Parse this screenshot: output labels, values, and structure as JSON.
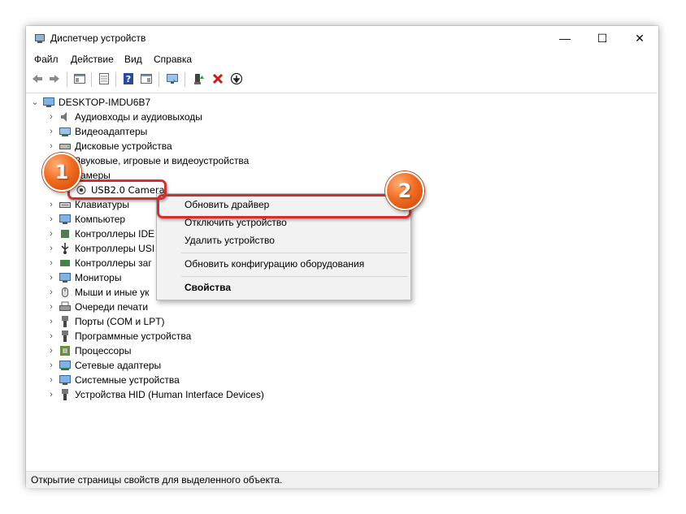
{
  "window": {
    "title": "Диспетчер устройств",
    "controls": {
      "minimize": "—",
      "maximize": "☐",
      "close": "✕"
    }
  },
  "menu": [
    "Файл",
    "Действие",
    "Вид",
    "Справка"
  ],
  "toolbar": {
    "icons": [
      "back-icon",
      "forward-icon",
      "show-hide-tree-icon",
      "properties-icon",
      "help-icon",
      "view-icon",
      "monitor-icon",
      "update-driver-icon",
      "uninstall-icon",
      "disable-icon"
    ]
  },
  "tree": {
    "root": "DESKTOP-IMDU6B7",
    "categories": [
      "Аудиовходы и аудиовыходы",
      "Видеоадаптеры",
      "Дисковые устройства",
      "Звуковые, игровые и видеоустройства",
      "Камеры",
      "USB2.0 Camera",
      "Клавиатуры",
      "Компьютер",
      "Контроллеры IDE",
      "Контроллеры USI",
      "Контроллеры заг",
      "Мониторы",
      "Мыши и иные ук",
      "Очереди печати",
      "Порты (COM и LPT)",
      "Программные устройства",
      "Процессоры",
      "Сетевые адаптеры",
      "Системные устройства",
      "Устройства HID (Human Interface Devices)"
    ]
  },
  "context_menu": {
    "items": [
      "Обновить драйвер",
      "Отключить устройство",
      "Удалить устройство",
      "Обновить конфигурацию оборудования",
      "Свойства"
    ]
  },
  "status": "Открытие страницы свойств для выделенного объекта.",
  "annotations": {
    "badge1": "1",
    "badge2": "2"
  },
  "colors": {
    "highlight": "#d32f2f",
    "badge": "#f26d21"
  }
}
